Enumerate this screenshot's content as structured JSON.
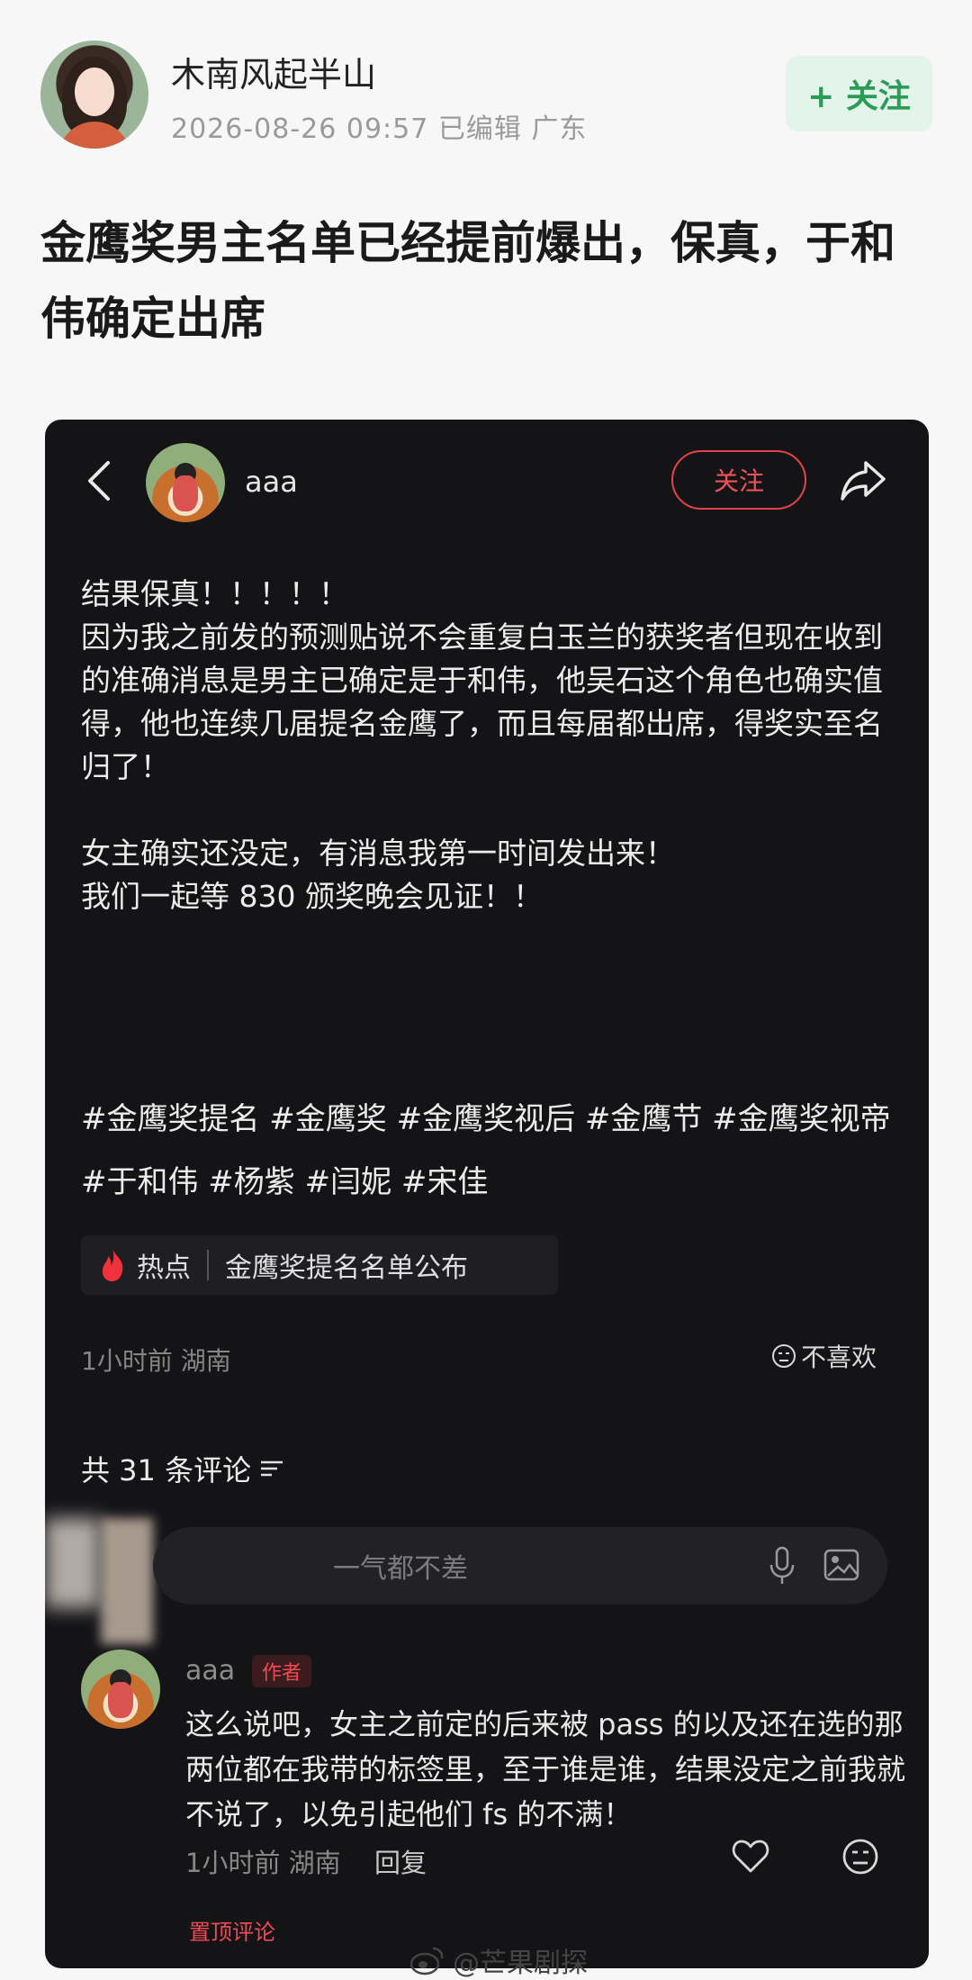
{
  "post": {
    "author": "木南风起半山",
    "meta": "2026-08-26 09:57  已编辑  广东",
    "follow_label": "+ 关注",
    "title": "金鹰奖男主名单已经提前爆出，保真，于和伟确定出席"
  },
  "screenshot": {
    "user": "aaa",
    "follow_label": "关注",
    "content": [
      "结果保真！！！！！",
      "因为我之前发的预测贴说不会重复白玉兰的获奖者但现在收到的准确消息是男主已确定是于和伟，他吴石这个角色也确实值得，他也连续几届提名金鹰了，而且每届都出席，得奖实至名归了！",
      "",
      "女主确实还没定，有消息我第一时间发出来！",
      "我们一起等 830 颁奖晚会见证！！"
    ],
    "tags": "#金鹰奖提名 #金鹰奖 #金鹰奖视后 #金鹰节 #金鹰奖视帝 #于和伟 #杨紫 #闫妮 #宋佳",
    "hot_label": "热点",
    "hot_topic": "金鹰奖提名名单公布",
    "time_loc": "1小时前 湖南",
    "dislike_label": "不喜欢",
    "comment_count": "共 31 条评论",
    "input_placeholder": "一气都不差",
    "comment": {
      "user": "aaa",
      "badge": "作者",
      "text": "这么说吧，女主之前定的后来被 pass 的以及还在选的那两位都在我带的标签里，至于谁是谁，结果没定之前我就不说了，以免引起他们 fs 的不满！",
      "time": "1小时前 湖南",
      "reply": "回复",
      "pinned": "置顶评论"
    }
  },
  "watermark": "@芒果剧探",
  "colors": {
    "accent_green": "#2c9b56",
    "accent_red": "#f04a55",
    "dark_bg": "#141417"
  }
}
